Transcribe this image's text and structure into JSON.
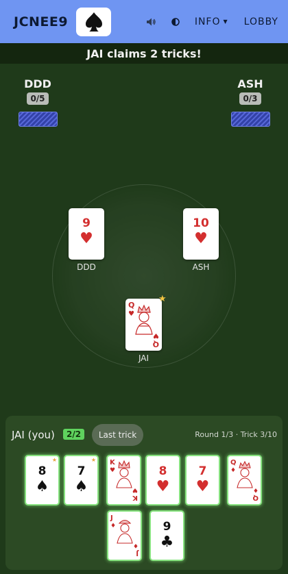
{
  "header": {
    "game_code": "JCNEE9",
    "info_label": "INFO",
    "lobby_label": "LOBBY",
    "accent": "#6f95f2"
  },
  "banner": {
    "message": "JAI claims 2 tricks!"
  },
  "opponents": [
    {
      "name": "DDD",
      "score": "0/5"
    },
    {
      "name": "ASH",
      "score": "0/3"
    }
  ],
  "trick": [
    {
      "player": "DDD",
      "rank": "9",
      "suit": "♥",
      "color": "red"
    },
    {
      "player": "ASH",
      "rank": "10",
      "suit": "♥",
      "color": "red"
    },
    {
      "player": "JAI",
      "rank": "Q",
      "suit": "♥",
      "color": "red",
      "winning": true
    }
  ],
  "me": {
    "name": "JAI (you)",
    "score": "2/2",
    "last_trick_label": "Last trick",
    "round_info": "Round 1/3 · Trick 3/10"
  },
  "hand": [
    {
      "rank": "8",
      "suit": "♠",
      "color": "black",
      "starred": true
    },
    {
      "rank": "7",
      "suit": "♠",
      "color": "black",
      "starred": true
    },
    {
      "rank": "K",
      "suit": "♥",
      "color": "red"
    },
    {
      "rank": "8",
      "suit": "♥",
      "color": "red"
    },
    {
      "rank": "7",
      "suit": "♥",
      "color": "red"
    },
    {
      "rank": "Q",
      "suit": "♦",
      "color": "red"
    },
    {
      "rank": "J",
      "suit": "♦",
      "color": "red"
    },
    {
      "rank": "9",
      "suit": "♣",
      "color": "black"
    }
  ]
}
